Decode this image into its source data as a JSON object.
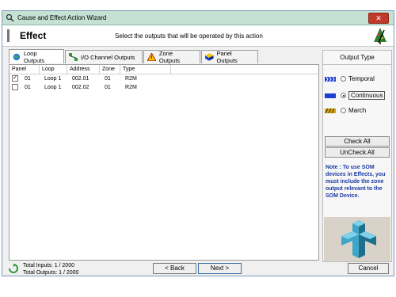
{
  "window": {
    "title": "Cause and Effect Action Wizard",
    "close_label": "✕"
  },
  "header": {
    "title": "Effect",
    "instruction": "Select the outputs that will be operated by this action"
  },
  "tabs": [
    {
      "label": "Loop Outputs",
      "icon": "globe-icon",
      "active": true
    },
    {
      "label": "I/O Channel Outputs",
      "icon": "network-icon",
      "active": false
    },
    {
      "label": "Zone Outputs",
      "icon": "warning-triangle-icon",
      "active": false
    },
    {
      "label": "Panel Outputs",
      "icon": "panel-box-icon",
      "active": false
    }
  ],
  "table": {
    "columns": [
      "Panel",
      "Loop",
      "Address",
      "Zone",
      "Type"
    ],
    "rows": [
      {
        "checked": true,
        "panel": "01",
        "loop": "Loop 1",
        "address": "002.01",
        "zone": "01",
        "type": "R2M"
      },
      {
        "checked": false,
        "panel": "01",
        "loop": "Loop 1",
        "address": "002.02",
        "zone": "01",
        "type": "R2M"
      }
    ]
  },
  "output_type": {
    "title": "Output Type",
    "options": [
      {
        "label": "Temporal",
        "selected": false,
        "swatch": "#1f3fd1"
      },
      {
        "label": "Continuous",
        "selected": true,
        "swatch": "#1f3fd1"
      },
      {
        "label": "March",
        "selected": false,
        "swatch": "#d6a400"
      }
    ],
    "check_all": "Check All",
    "uncheck_all": "UnCheck All",
    "note": "Note : To use SOM devices in Effects, you must include the zone output relevant to the SOM Device."
  },
  "footer": {
    "total_inputs": "Total Inputs:   1 / 2000",
    "total_outputs": "Total Outputs:  1 / 2000",
    "back": "< Back",
    "next": "Next >",
    "cancel": "Cancel"
  },
  "colors": {
    "accent": "#c4e1d4",
    "note_text": "#1a3aa0"
  }
}
